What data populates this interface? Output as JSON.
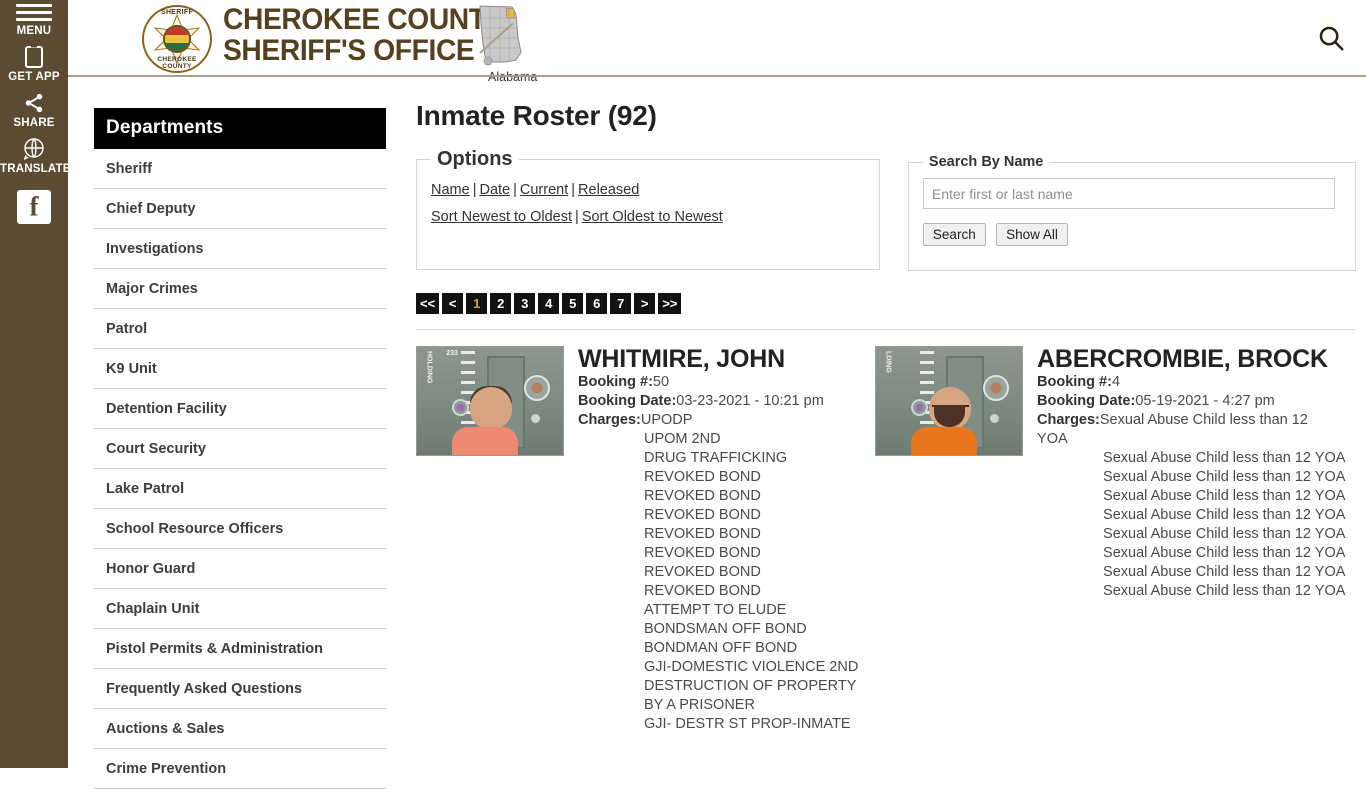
{
  "rail": {
    "items": [
      {
        "label": "MENU",
        "icon": "hamburger-icon"
      },
      {
        "label": "GET APP",
        "icon": "mobile-phone-icon"
      },
      {
        "label": "SHARE",
        "icon": "share-icon"
      },
      {
        "label": "TRANSLATE",
        "icon": "globe-translate-icon"
      },
      {
        "label": "f",
        "icon": "facebook-icon"
      }
    ]
  },
  "header": {
    "title_line1": "CHEROKEE COUNTY",
    "title_line2": "SHERIFF'S OFFICE",
    "badge_top": "SHERIFF",
    "badge_bottom": "CHEROKEE COUNTY",
    "map_caption": "Alabama",
    "search_icon": "search-icon",
    "brand_color": "#55401f",
    "rail_color": "#5b4b33"
  },
  "sidebar": {
    "heading": "Departments",
    "items": [
      {
        "label": "Sheriff"
      },
      {
        "label": "Chief Deputy"
      },
      {
        "label": "Investigations"
      },
      {
        "label": "Major Crimes"
      },
      {
        "label": "Patrol"
      },
      {
        "label": "K9 Unit"
      },
      {
        "label": "Detention Facility"
      },
      {
        "label": "Court Security"
      },
      {
        "label": "Lake Patrol"
      },
      {
        "label": "School Resource Officers"
      },
      {
        "label": "Honor Guard"
      },
      {
        "label": "Chaplain Unit"
      },
      {
        "label": "Pistol Permits & Administration"
      },
      {
        "label": "Frequently Asked Questions"
      },
      {
        "label": "Auctions & Sales"
      },
      {
        "label": "Crime Prevention"
      }
    ]
  },
  "main": {
    "page_title": "Inmate Roster (92)",
    "options": {
      "legend": "Options",
      "row1": [
        "Name",
        "Date",
        "Current",
        "Released"
      ],
      "row2": [
        "Sort Newest to Oldest",
        "Sort Oldest to Newest"
      ],
      "separator": "|"
    },
    "search": {
      "legend": "Search By Name",
      "input_value": "",
      "placeholder": "Enter first or last name",
      "search_label": "Search",
      "show_all_label": "Show All"
    },
    "pagination": {
      "items": [
        "<<",
        "<",
        "1",
        "2",
        "3",
        "4",
        "5",
        "6",
        "7",
        ">",
        ">>"
      ],
      "active": "1",
      "active_color": "#d9a520"
    },
    "labels": {
      "booking_number": "Booking #:",
      "booking_date": "Booking Date:",
      "charges": "Charges:"
    },
    "inmates": [
      {
        "name": "WHITMIRE, JOHN",
        "booking_number": "50",
        "booking_date": "03-23-2021 - 10:21 pm",
        "mugshot_alt": "mugshot-whitmire-john",
        "charges": [
          "UPODP",
          "UPOM 2ND",
          "DRUG TRAFFICKING",
          "REVOKED BOND",
          "REVOKED BOND",
          "REVOKED BOND",
          "REVOKED BOND",
          "REVOKED BOND",
          "REVOKED BOND",
          "REVOKED BOND",
          "ATTEMPT TO ELUDE",
          "BONDSMAN OFF BOND",
          "BONDMAN OFF BOND",
          "GJI-DOMESTIC VIOLENCE 2ND",
          "DESTRUCTION OF PROPERTY BY A PRISONER",
          "GJI- DESTR ST PROP-INMATE"
        ]
      },
      {
        "name": "ABERCROMBIE, BROCK",
        "booking_number": "4",
        "booking_date": "05-19-2021 - 4:27 pm",
        "mugshot_alt": "mugshot-abercrombie-brock",
        "charges": [
          "Sexual Abuse Child less than 12 YOA",
          "Sexual Abuse Child less than 12 YOA",
          "Sexual Abuse Child less than 12 YOA",
          "Sexual Abuse Child less than 12 YOA",
          "Sexual Abuse Child less than 12 YOA",
          "Sexual Abuse Child less than 12 YOA",
          "Sexual Abuse Child less than 12 YOA",
          "Sexual Abuse Child less than 12 YOA",
          "Sexual Abuse Child less than 12 YOA"
        ]
      }
    ]
  }
}
